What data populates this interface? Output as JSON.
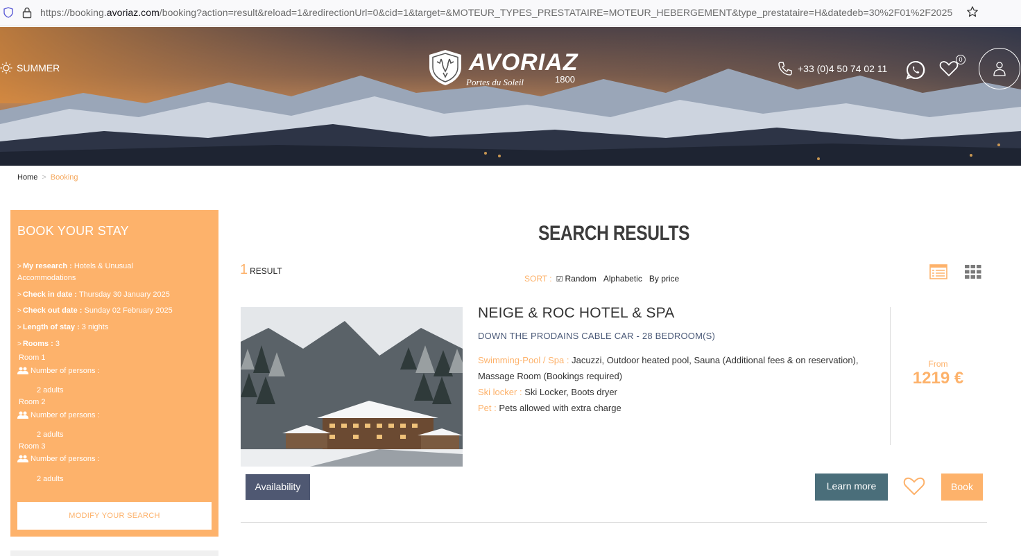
{
  "browser": {
    "url_prefix": "https://booking.",
    "url_host": "avoriaz.com",
    "url_rest": "/booking?action=result&reload=1&redirectionUrl=0&cid=1&target=&MOTEUR_TYPES_PRESTATAIRE=MOTEUR_HEBERGEMENT&type_prestataire=H&datedeb=30%2F01%2F2025"
  },
  "header": {
    "season": "SUMMER",
    "logo_word": "AVORIAZ",
    "logo_sub": "Portes du Soleil",
    "logo_alt": "1800",
    "phone": "+33 (0)4 50 74 02 11",
    "favorites_count": "0"
  },
  "breadcrumb": {
    "home": "Home",
    "current": "Booking"
  },
  "sidebar": {
    "title": "BOOK YOUR STAY",
    "research_label": "My research :",
    "research_value": "Hotels & Unusual Accommodations",
    "checkin_label": "Check in date :",
    "checkin_value": "Thursday 30 January 2025",
    "checkout_label": "Check out date :",
    "checkout_value": "Sunday 02 February 2025",
    "length_label": "Length of stay :",
    "length_value": "3 nights",
    "rooms_label": "Rooms :",
    "rooms_value": "3",
    "persons_label": "Number of persons :",
    "rooms": [
      {
        "name": "Room 1",
        "adults": "2 adults"
      },
      {
        "name": "Room 2",
        "adults": "2 adults"
      },
      {
        "name": "Room 3",
        "adults": "2 adults"
      }
    ],
    "modify_label": "MODIFY YOUR SEARCH"
  },
  "results": {
    "title": "SEARCH RESULTS",
    "count": "1",
    "count_label": "RESULT",
    "sort_label": "SORT :",
    "sort_options": [
      "Random",
      "Alphabetic",
      "By price"
    ],
    "sort_selected": "Random"
  },
  "hotel": {
    "name": "NEIGE & ROC HOTEL & SPA",
    "subtitle": "DOWN THE PRODAINS CABLE CAR - 28 BEDROOM(S)",
    "features": [
      {
        "key": "Swimming-Pool / Spa :",
        "value": "Jacuzzi, Outdoor heated pool, Sauna (Additional fees & on reservation), Massage Room (Bookings required)"
      },
      {
        "key": "Ski locker :",
        "value": "Ski Locker, Boots dryer"
      },
      {
        "key": "Pet :",
        "value": "Pets allowed with extra charge"
      }
    ],
    "from_label": "From",
    "price": "1219 €",
    "availability_label": "Availability",
    "learn_more_label": "Learn more",
    "book_label": "Book"
  },
  "colors": {
    "accent": "#fdb26b",
    "navy": "#4f5872",
    "teal": "#4a6e7a"
  }
}
